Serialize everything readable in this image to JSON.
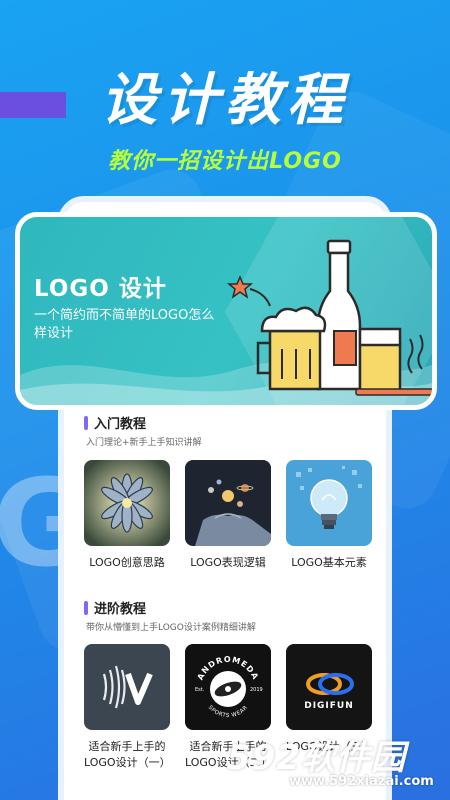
{
  "hero": {
    "title": "设计教程",
    "subtitle": "教你一招设计出LOGO",
    "bg_letter": "GO"
  },
  "banner": {
    "title": "LOGO 设计",
    "description": "一个简约而不简单的LOGO怎么样设计",
    "art": "bottle-and-beer-illustration"
  },
  "sections": [
    {
      "title": "入门教程",
      "subtitle": "入门理论+新手上手知识讲解",
      "cards": [
        {
          "label": "LOGO创意思路",
          "thumb": "radial-petal-artwork"
        },
        {
          "label": "LOGO表现逻辑",
          "thumb": "planets-in-hand"
        },
        {
          "label": "LOGO基本元素",
          "thumb": "lightbulb"
        }
      ]
    },
    {
      "title": "进阶教程",
      "subtitle": "带你从懵懂到上手LOGO设计案例精细讲解",
      "cards": [
        {
          "label": "适合新手上手的LOGO设计（一）",
          "thumb": "wave-v-logo"
        },
        {
          "label": "适合新手上手的LOGO设计（二）",
          "thumb": "andromeda-badge",
          "badge_top": "ANDROMEDA",
          "badge_bottom": "SPORTS WEAR",
          "badge_left": "Est.",
          "badge_right": "2019"
        },
        {
          "label": "LOGO设计（三）",
          "thumb": "digifun-logo",
          "brand": "DIGIFUN"
        }
      ]
    }
  ],
  "watermark": {
    "brand": "592软件园",
    "url": "www.592xiazai.com"
  },
  "colors": {
    "background": "#1c8fea",
    "accent_green": "#b6ff3a",
    "banner_teal": "#36c2c4",
    "section_bar": "#7d6cf0"
  }
}
